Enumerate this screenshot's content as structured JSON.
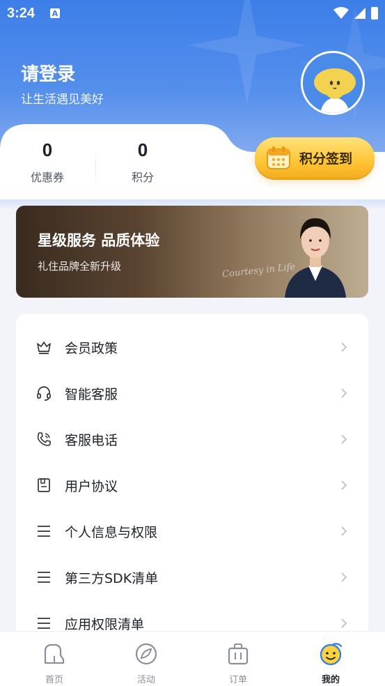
{
  "status_bar": {
    "time": "3:24",
    "notification_glyph": "A"
  },
  "header": {
    "title": "请登录",
    "subtitle": "让生活遇见美好"
  },
  "stats": [
    {
      "value": "0",
      "label": "优惠券"
    },
    {
      "value": "0",
      "label": "积分"
    }
  ],
  "signin_button": {
    "label": "积分签到"
  },
  "banner": {
    "title": "星级服务 品质体验",
    "subtitle": "礼住品牌全新升级",
    "script_text": "Courtesy in Life"
  },
  "menu": [
    {
      "label": "会员政策",
      "icon": "crown-icon"
    },
    {
      "label": "智能客服",
      "icon": "headset-icon"
    },
    {
      "label": "客服电话",
      "icon": "phone-icon"
    },
    {
      "label": "用户协议",
      "icon": "document-icon"
    },
    {
      "label": "个人信息与权限",
      "icon": "list-icon"
    },
    {
      "label": "第三方SDK清单",
      "icon": "list-icon"
    },
    {
      "label": "应用权限清单",
      "icon": "list-icon"
    }
  ],
  "tabs": [
    {
      "label": "首页",
      "icon": "home-icon",
      "active": false
    },
    {
      "label": "活动",
      "icon": "compass-icon",
      "active": false
    },
    {
      "label": "订单",
      "icon": "bag-icon",
      "active": false
    },
    {
      "label": "我的",
      "icon": "smile-icon",
      "active": true
    }
  ],
  "colors": {
    "primary_blue": "#3c7ee8",
    "gold": "#ffc83b",
    "text": "#1d2129",
    "muted": "#8a8f99"
  }
}
